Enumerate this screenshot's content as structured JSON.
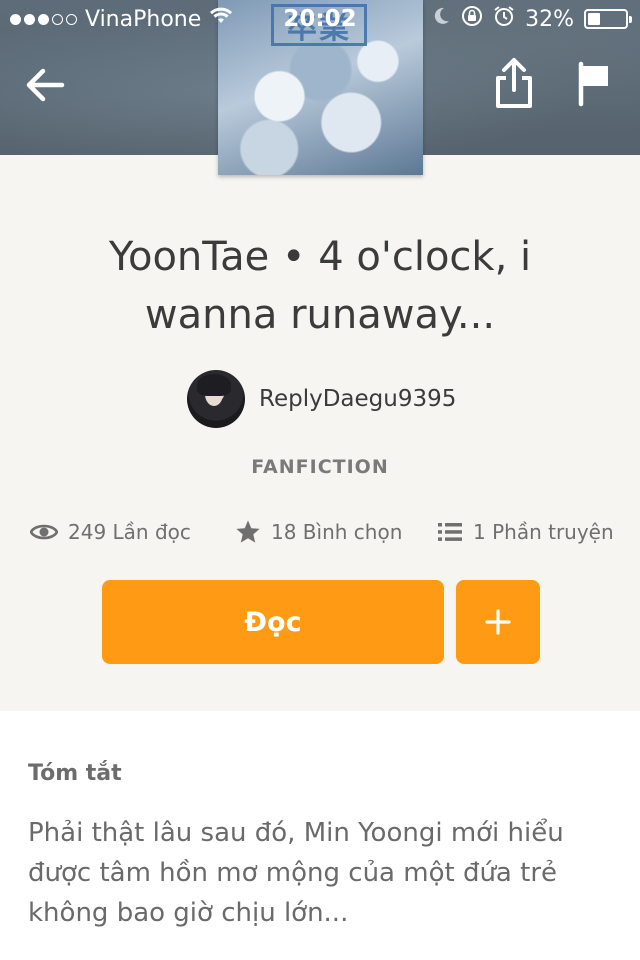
{
  "status_bar": {
    "signal_full": 3,
    "signal_empty": 2,
    "carrier": "VinaPhone",
    "time": "20:02",
    "battery_percent": "32%",
    "battery_level": 0.32,
    "icons": [
      "wifi-icon",
      "moon-icon",
      "rotation-lock-icon",
      "alarm-icon",
      "battery-icon"
    ]
  },
  "header": {
    "back_icon": "arrow-left-icon",
    "share_icon": "share-icon",
    "flag_icon": "flag-icon",
    "cover_mark": "卒業"
  },
  "story": {
    "title": "YoonTae • 4 o'clock, i wanna runaway...",
    "author": "ReplyDaegu9395",
    "category": "FANFICTION"
  },
  "stats": {
    "reads": "249 Lần đọc",
    "votes": "18 Bình chọn",
    "parts": "1 Phần truyện"
  },
  "actions": {
    "read_label": "Đọc",
    "add_icon": "plus-icon"
  },
  "summary": {
    "label": "Tóm tắt",
    "text": "Phải thật lâu sau đó, Min Yoongi mới hiểu được tâm hồn mơ mộng của một đứa trẻ không bao giờ chịu lớn..."
  },
  "colors": {
    "accent": "#ff9a14",
    "background": "#f6f5f1",
    "banner": "#5a6975"
  }
}
